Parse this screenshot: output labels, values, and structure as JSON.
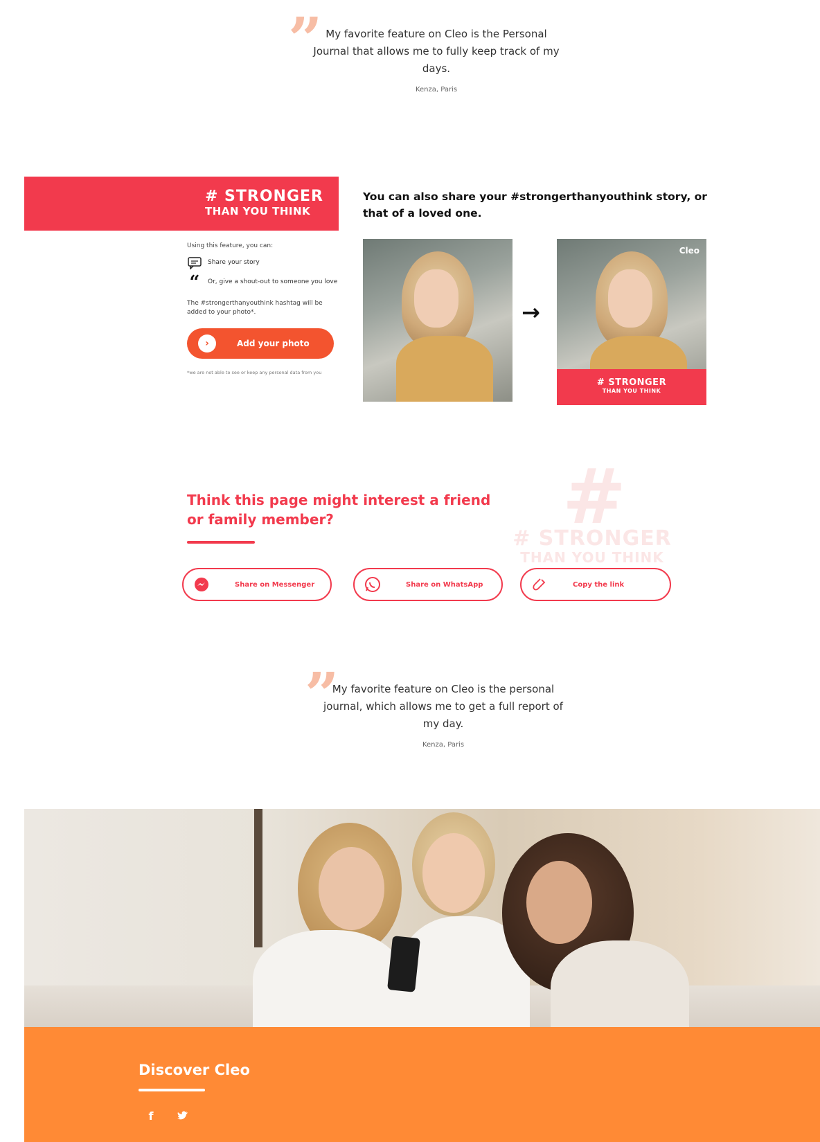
{
  "testimonial_top": {
    "quote": "My favorite feature on Cleo is the Personal Journal that allows me to fully keep track of my days.",
    "author": "Kenza, Paris"
  },
  "stronger": {
    "banner_line1": "# STRONGER",
    "banner_line2": "THAN YOU THINK",
    "intro": "Using this feature, you can:",
    "features": [
      {
        "icon": "chat-icon",
        "label": "Share your story"
      },
      {
        "icon": "quote-icon",
        "label": "Or, give a shout-out to someone you love"
      }
    ],
    "note": "The #strongerthanyouthink hashtag will be added to your photo*.",
    "add_photo_label": "Add your photo",
    "footnote": "*we are not able to see or keep any personal data from you",
    "share_title": "You can also share your #strongerthanyouthink story, or that of a loved one.",
    "arrow": "→",
    "overlay_line1": "# STRONGER",
    "overlay_line2": "THAN YOU THINK",
    "cleo_mark": "Cleo"
  },
  "share": {
    "title": "Think this page might interest a friend or family member?",
    "watermark_hash": "#",
    "watermark_line1": "# STRONGER",
    "watermark_line2": "THAN YOU THINK",
    "buttons": [
      {
        "icon": "messenger-icon",
        "label": "Share on Messenger"
      },
      {
        "icon": "whatsapp-icon",
        "label": "Share on WhatsApp"
      },
      {
        "icon": "link-icon",
        "label": "Copy the link"
      }
    ]
  },
  "testimonial_bottom": {
    "quote": "My favorite feature on Cleo is the personal journal, which allows me to get a full report of my day.",
    "author": "Kenza, Paris"
  },
  "footer": {
    "title": "Discover Cleo",
    "social": [
      {
        "icon": "facebook-icon",
        "glyph": "f"
      },
      {
        "icon": "twitter-icon",
        "glyph": "🐦"
      }
    ]
  },
  "colors": {
    "brand_red": "#f23a4d",
    "brand_orange": "#ff8a35",
    "button_orange": "#f3542f",
    "quote_mark": "#f7bda5"
  }
}
